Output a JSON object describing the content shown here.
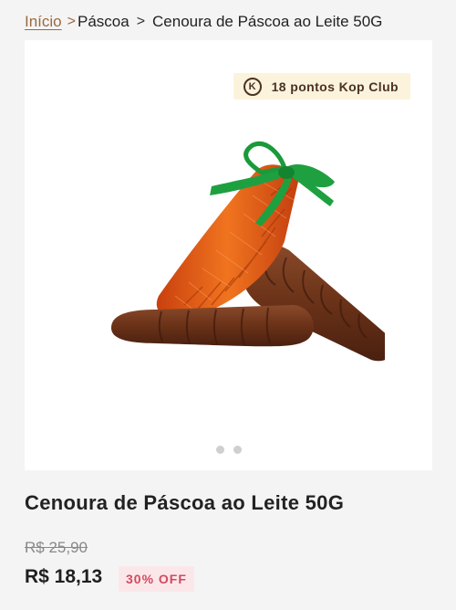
{
  "breadcrumb": {
    "home": "Início",
    "sep1": ">",
    "category": "Páscoa",
    "sep2": ">",
    "current": "Cenoura de Páscoa ao Leite 50G"
  },
  "gallery": {
    "points_icon_letter": "K",
    "points_text": "18 pontos Kop Club",
    "slide_count": 2,
    "active_slide": 1
  },
  "product": {
    "title": "Cenoura de Páscoa ao Leite 50G",
    "old_price": "R$ 25,90",
    "price": "R$ 18,13",
    "discount": "30% OFF"
  },
  "colors": {
    "accent_brown": "#9a6a40",
    "badge_bg": "#fcf3dc",
    "discount_bg": "#fbe7ea",
    "discount_text": "#d24a5f"
  }
}
